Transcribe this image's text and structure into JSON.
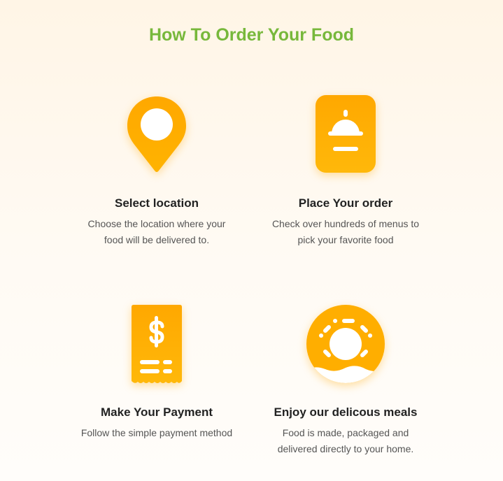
{
  "title": "How To Order Your Food",
  "colors": {
    "accent": "#ffad00",
    "title": "#77b83b"
  },
  "steps": [
    {
      "icon": "location-pin-icon",
      "heading": "Select location",
      "text": "Choose the location where your food will be delivered to."
    },
    {
      "icon": "food-cloche-menu-icon",
      "heading": "Place Your order",
      "text": "Check over hundreds of menus to pick your favorite food"
    },
    {
      "icon": "receipt-dollar-icon",
      "heading": "Make Your Payment",
      "text": "Follow the simple payment method"
    },
    {
      "icon": "donut-icon",
      "heading": "Enjoy our delicous meals",
      "text": "Food is made, packaged and delivered directly to your home."
    }
  ]
}
